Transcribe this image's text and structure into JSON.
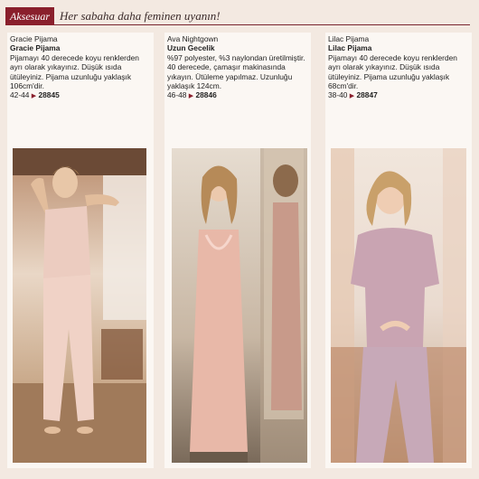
{
  "header": {
    "section_tag": "Aksesuar",
    "tagline": "Her sabaha daha feminen uyanın!"
  },
  "products": [
    {
      "name_en": "Gracie Pijama",
      "name_tr": "Gracie Pijama",
      "desc": "Pijamayı 40 derecede koyu renklerden ayrı olarak yıkayınız. Düşük ısıda ütüleyiniz. Pijama uzunluğu yaklaşık 106cm'dir.",
      "sizes": "42-44",
      "code": "28845"
    },
    {
      "name_en": "Ava Nightgown",
      "name_tr": "Uzun Gecelik",
      "desc": "%97 polyester, %3 naylondan üretilmiştir. 40 derecede, çamaşır makinasında yıkayın. Ütüleme yapılmaz. Uzunluğu yaklaşık 124cm.",
      "sizes": "46-48",
      "code": "28846"
    },
    {
      "name_en": "Lilac Pijama",
      "name_tr": "Lilac Pijama",
      "desc": "Pijamayı 40 derecede koyu renklerden ayrı olarak yıkayınız. Düşük ısıda ütüleyiniz. Pijama uzunluğu yaklaşık 68cm'dir.",
      "sizes": "38-40",
      "code": "28847"
    }
  ],
  "colors": {
    "accent": "#8a1f2c",
    "background": "#f3e9e1",
    "panel": "#fbf7f3"
  }
}
